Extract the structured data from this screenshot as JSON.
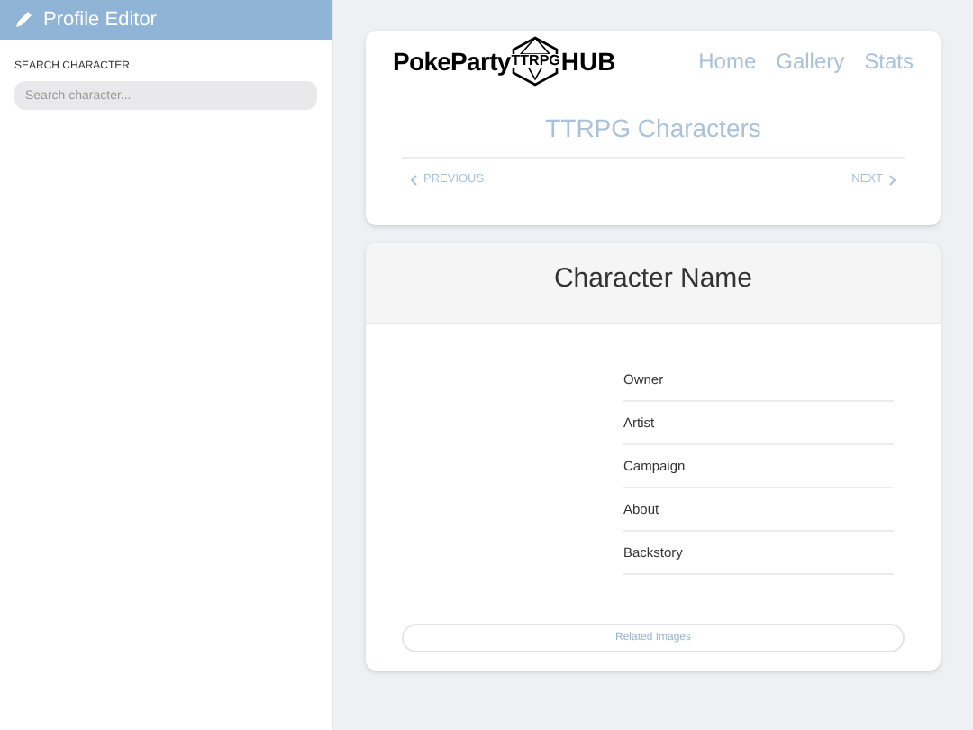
{
  "sidebar": {
    "title": "Profile Editor",
    "search_label": "SEARCH CHARACTER",
    "search": {
      "placeholder": "Search character..."
    }
  },
  "header": {
    "logo": {
      "left": "PokeParty",
      "middle": "TTRPG",
      "right": "HUB"
    },
    "nav": [
      "Home",
      "Gallery",
      "Stats"
    ],
    "page_title": "TTRPG Characters",
    "previous": "PREVIOUS",
    "next": "NEXT"
  },
  "character": {
    "name": "Character Name",
    "fields": [
      "Owner",
      "Artist",
      "Campaign",
      "About",
      "Backstory"
    ],
    "related_button": "Related Images"
  }
}
